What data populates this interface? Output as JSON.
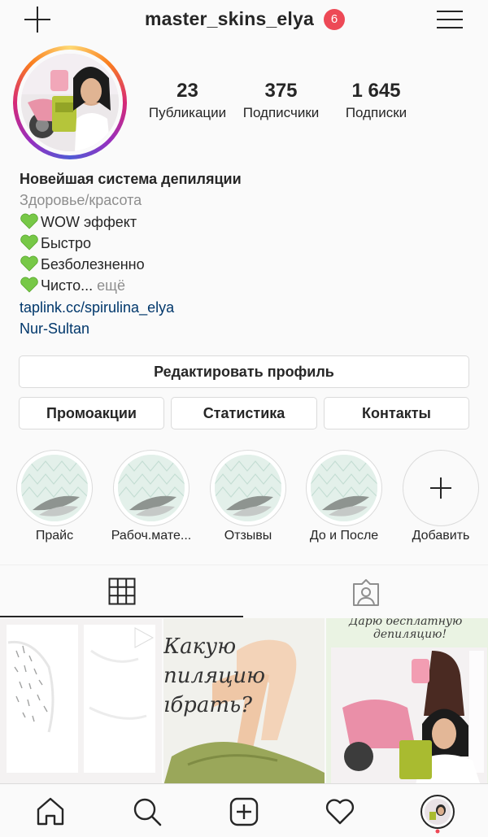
{
  "header": {
    "username": "master_skins_elya",
    "notification_count": "6",
    "new_post_icon": "plus-icon",
    "menu_icon": "hamburger-menu-icon"
  },
  "stats": [
    {
      "value": "23",
      "label": "Публикации"
    },
    {
      "value": "375",
      "label": "Подписчики"
    },
    {
      "value": "1 645",
      "label": "Подписки"
    }
  ],
  "bio": {
    "name": "Новейшая система депиляции",
    "category": "Здоровье/красота",
    "lines": [
      "WOW эффект",
      "Быстро",
      "Безболезненно",
      "Чисто..."
    ],
    "more": "ещё",
    "link": "taplink.cc/spirulina_elya",
    "location": "Nur-Sultan"
  },
  "buttons": {
    "edit_profile": "Редактировать профиль",
    "promotions": "Промоакции",
    "insights": "Статистика",
    "contacts": "Контакты"
  },
  "highlights": [
    {
      "label": "Прайс"
    },
    {
      "label": "Рабоч.мате..."
    },
    {
      "label": "Отзывы"
    },
    {
      "label": "До и После"
    },
    {
      "label": "Добавить"
    }
  ],
  "tabs": [
    {
      "name": "grid",
      "icon": "grid-icon",
      "active": true
    },
    {
      "name": "tagged",
      "icon": "tagged-person-icon",
      "active": false
    }
  ],
  "posts": [
    {
      "kind": "before-after",
      "has_video_icon": true
    },
    {
      "kind": "text-image",
      "text_lines": [
        "Какую",
        "пиляцию",
        "ıбрать?"
      ]
    },
    {
      "kind": "photo",
      "caption_lines": [
        "Дарю бесплатную",
        "депиляцию!"
      ]
    }
  ],
  "bottom_nav": [
    {
      "icon": "home-icon"
    },
    {
      "icon": "search-icon"
    },
    {
      "icon": "add-post-icon"
    },
    {
      "icon": "heart-icon"
    },
    {
      "icon": "profile-avatar-icon"
    }
  ],
  "colors": {
    "badge": "#ed4956",
    "link": "#00376b",
    "secondary_text": "#8e8e8e",
    "heart_emoji": "#77c847",
    "border": "#dbdbdb"
  }
}
